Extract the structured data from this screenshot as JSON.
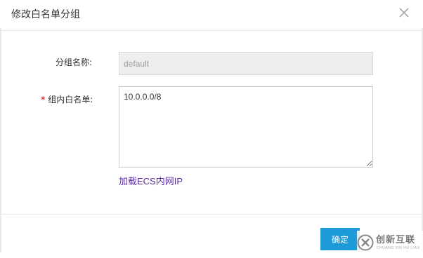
{
  "dialog": {
    "title": "修改白名单分组",
    "close_icon": "close-icon"
  },
  "form": {
    "group_name_label": "分组名称:",
    "group_name_value": "default",
    "whitelist_required_mark": "*",
    "whitelist_label": "组内白名单:",
    "whitelist_value": "10.0.0.0/8",
    "load_ecs_link": "加载ECS内网IP"
  },
  "footer": {
    "confirm_label": "确定"
  },
  "watermark": {
    "text": "创新互联",
    "subtext": "CHUANG XIN HU LIAN"
  },
  "colors": {
    "primary": "#1d9ad8",
    "link": "#5e2ca5",
    "required": "#e4393c",
    "disabled_bg": "#eeeeee"
  }
}
